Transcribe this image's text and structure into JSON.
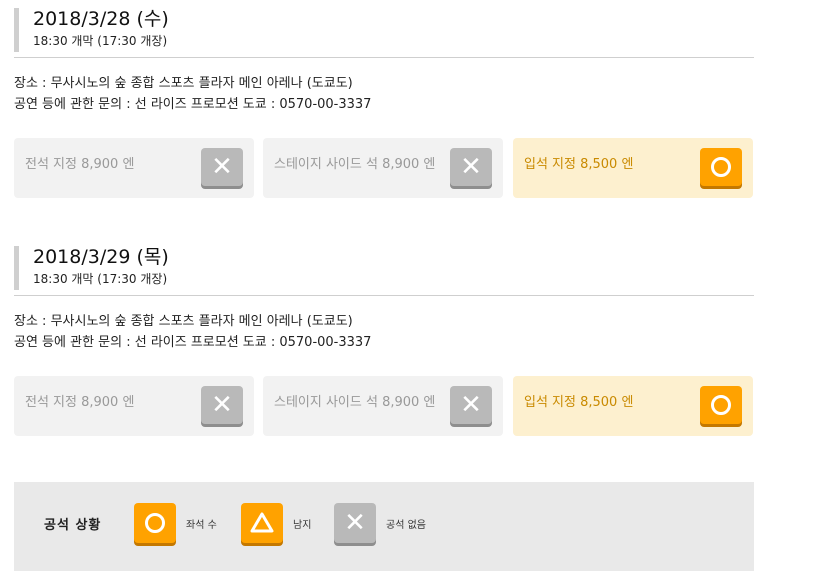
{
  "events": [
    {
      "date": "2018/3/28 (수)",
      "time": "18:30 개막 (17:30 개장)",
      "venue": "장소 : 무사시노의 숲 종합 스포츠 플라자 메인 아레나 (도쿄도)",
      "inquiry": "공연 등에 관한 문의 : 선 라이즈 프로모션 도쿄 : 0570-00-3337",
      "tickets": [
        {
          "label": "전석 지정 8,900 엔",
          "status": "x"
        },
        {
          "label": "스테이지 사이드 석 8,900 엔",
          "status": "x"
        },
        {
          "label": "입석 지정 8,500 엔",
          "status": "o"
        }
      ]
    },
    {
      "date": "2018/3/29 (목)",
      "time": "18:30 개막 (17:30 개장)",
      "venue": "장소 : 무사시노의 숲 종합 스포츠 플라자 메인 아레나 (도쿄도)",
      "inquiry": "공연 등에 관한 문의 : 선 라이즈 프로모션 도쿄 : 0570-00-3337",
      "tickets": [
        {
          "label": "전석 지정 8,900 엔",
          "status": "x"
        },
        {
          "label": "스테이지 사이드 석 8,900 엔",
          "status": "x"
        },
        {
          "label": "입석 지정 8,500 엔",
          "status": "o"
        }
      ]
    }
  ],
  "legend": {
    "title": "공석 상황",
    "items": [
      {
        "icon": "circle-icon",
        "label": "좌석 수"
      },
      {
        "icon": "triangle-icon",
        "label": "남지"
      },
      {
        "icon": "x-icon",
        "label": "공석 없음"
      }
    ]
  },
  "colors": {
    "available": "#ffa200",
    "soldout": "#b9b9b9",
    "available_bg": "#fdf0cf",
    "card_bg": "#f2f2f2"
  }
}
